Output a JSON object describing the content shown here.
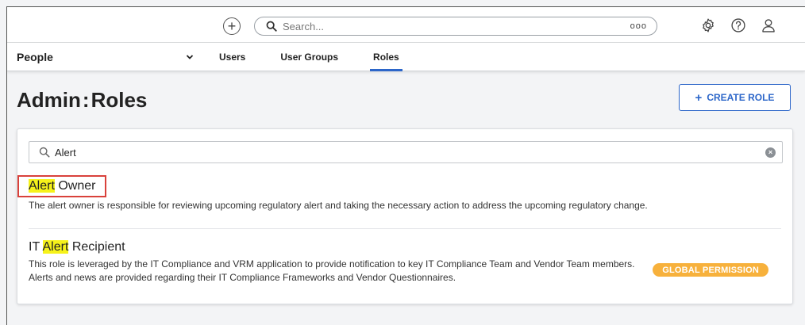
{
  "topbar": {
    "search_placeholder": "Search...",
    "search_options": "ooo"
  },
  "navbar": {
    "module_label": "People",
    "tabs": [
      {
        "label": "Users",
        "active": false
      },
      {
        "label": "User Groups",
        "active": false
      },
      {
        "label": "Roles",
        "active": true
      }
    ]
  },
  "page": {
    "title_prefix": "Admin",
    "title_separator": ":",
    "title_suffix": "Roles",
    "create_button_label": "CREATE ROLE"
  },
  "filter": {
    "value": "Alert"
  },
  "results": [
    {
      "name_before": "",
      "name_highlight": "Alert",
      "name_after": " Owner",
      "description": "The alert owner is responsible for reviewing upcoming regulatory alert and taking the necessary action to address the upcoming regulatory change."
    },
    {
      "name_before": "IT ",
      "name_highlight": "Alert",
      "name_after": " Recipient",
      "description": "This role is leveraged by the IT Compliance and VRM application to provide notification to key IT Compliance Team and Vendor Team members. Alerts and news are provided regarding their IT Compliance Frameworks and Vendor Questionnaires.",
      "badge": "GLOBAL PERMISSION"
    }
  ],
  "colors": {
    "accent": "#2c66c9",
    "highlight": "#f6f21a",
    "badge": "#f7b13c",
    "annotation_box": "#d9413b"
  },
  "icons": {
    "add": "plus-circle-icon",
    "search": "search-icon",
    "settings": "gear-icon",
    "help": "help-icon",
    "user": "user-icon",
    "module_dropdown": "chevron-down-icon",
    "clear": "clear-icon"
  }
}
